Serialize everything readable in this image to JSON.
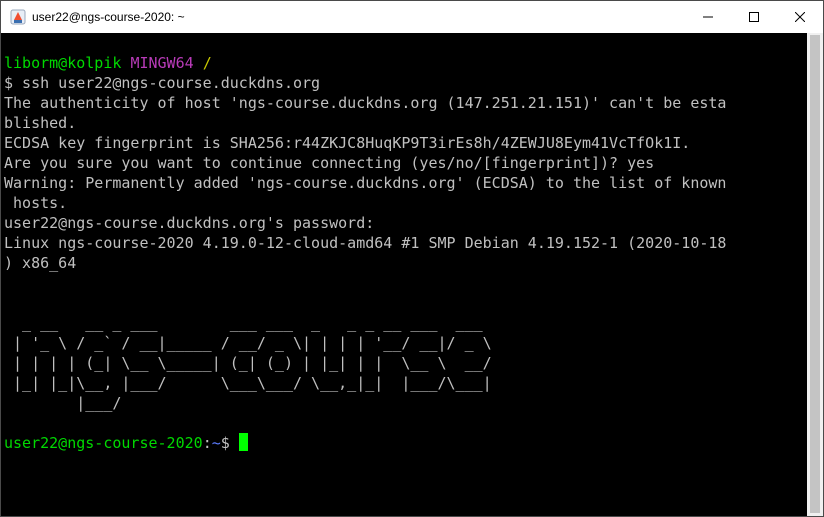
{
  "window": {
    "title": "user22@ngs-course-2020: ~",
    "icon": "git-bash-icon",
    "buttons": {
      "minimize": "minimize-icon",
      "maximize": "maximize-icon",
      "close": "close-icon"
    }
  },
  "terminal": {
    "colors": {
      "background": "#000000",
      "text": "#c0c0c0",
      "prompt_green": "#00d900",
      "prompt_magenta": "#b83bb8",
      "prompt_yellow": "#c8c800",
      "cursor": "#00ff00"
    },
    "local_prompt": {
      "user_host": "liborm@kolpik",
      "system": "MINGW64",
      "path": "/"
    },
    "command_line": "$ ssh user22@ngs-course.duckdns.org",
    "output_lines": [
      "The authenticity of host 'ngs-course.duckdns.org (147.251.21.151)' can't be esta",
      "blished.",
      "ECDSA key fingerprint is SHA256:r44ZKJC8HuqKP9T3irEs8h/4ZEWJU8Eym41VcTfOk1I.",
      "Are you sure you want to continue connecting (yes/no/[fingerprint])? yes",
      "Warning: Permanently added 'ngs-course.duckdns.org' (ECDSA) to the list of known",
      " hosts.",
      "user22@ngs-course.duckdns.org's password:",
      "Linux ngs-course-2020 4.19.0-12-cloud-amd64 #1 SMP Debian 4.19.152-1 (2020-10-18",
      ") x86_64"
    ],
    "banner_lines": [
      "  _ __   __ _ ___        ___ ___  _   _ _ __ ___  ___",
      " | '_ \\ / _` / __|_____ / __/ _ \\| | | | '__/ __|/ _ \\",
      " | | | | (_| \\__ \\_____| (_| (_) | |_| | |  \\__ \\  __/",
      " |_| |_|\\__, |___/      \\___\\___/ \\__,_|_|  |___/\\___|",
      "        |___/"
    ],
    "remote_prompt": {
      "user_host": "user22@ngs-course-2020",
      "separator": ":",
      "path": "~",
      "symbol": "$"
    }
  }
}
